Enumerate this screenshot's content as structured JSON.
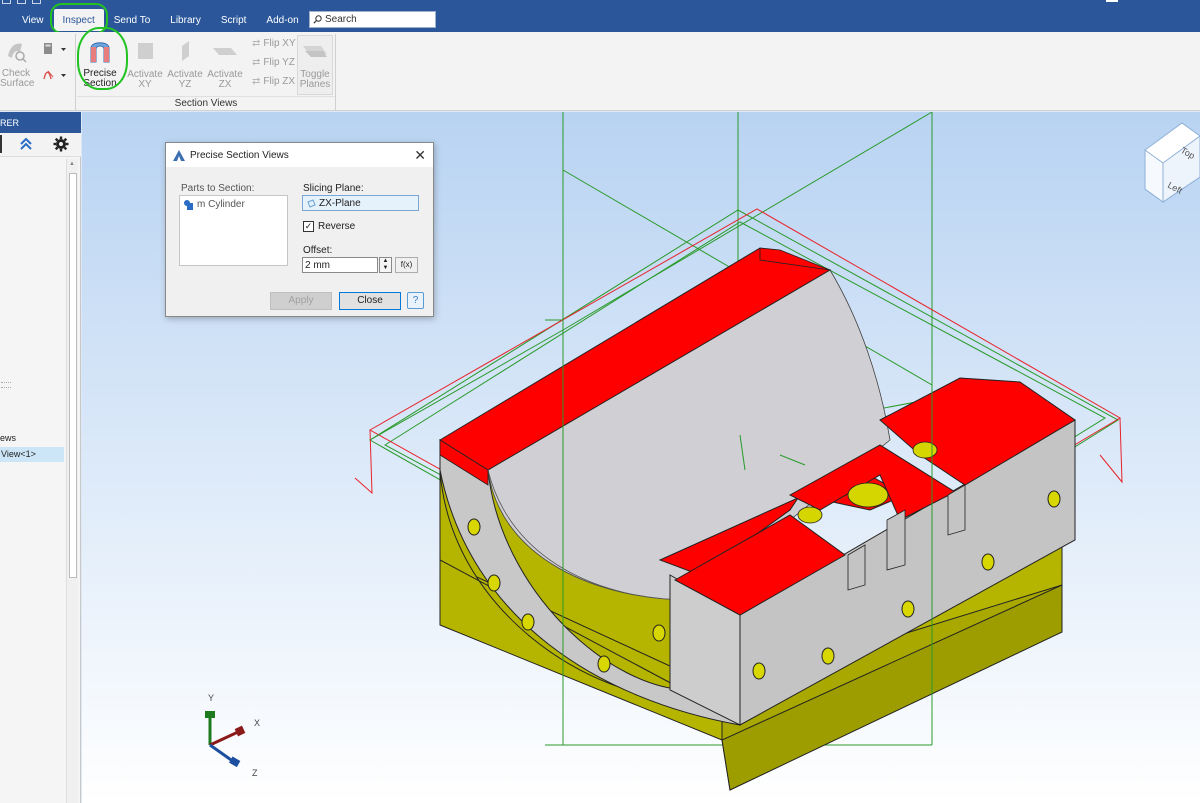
{
  "menu": {
    "items": [
      "View",
      "Inspect",
      "Send To",
      "Library",
      "Script",
      "Add-on"
    ],
    "active": "Inspect",
    "search_placeholder": "Search"
  },
  "ribbon": {
    "check_surface": "Check\nSurface",
    "precise_section": "Precise\nSection",
    "activate_xy": "Activate\nXY",
    "activate_yz": "Activate\nYZ",
    "activate_zx": "Activate\nZX",
    "flip_xy": "Flip XY",
    "flip_yz": "Flip YZ",
    "flip_zx": "Flip ZX",
    "toggle_planes": "Toggle\nPlanes",
    "group_label": "Section Views"
  },
  "left_panel": {
    "header": "RER",
    "node_views": "ews",
    "node_selected": "View<1>"
  },
  "dialog": {
    "title": "Precise Section Views",
    "parts_label": "Parts to Section:",
    "parts": [
      "m Cylinder"
    ],
    "slicing_label": "Slicing Plane:",
    "slicing_value": "ZX-Plane",
    "reverse_label": "Reverse",
    "reverse_checked": true,
    "offset_label": "Offset:",
    "offset_value": "2 mm",
    "fx_label": "f(x)",
    "apply_label": "Apply",
    "close_label": "Close",
    "help_label": "?"
  },
  "viewcube": {
    "top": "Top",
    "left": "Left"
  },
  "triad": {
    "x": "X",
    "y": "Y",
    "z": "Z"
  },
  "colors": {
    "titlebar": "#2b579a",
    "section_face": "#ff0000",
    "part_body": "#b5b500",
    "part_grey": "#c8c8c8",
    "highlight": "#22c322"
  }
}
